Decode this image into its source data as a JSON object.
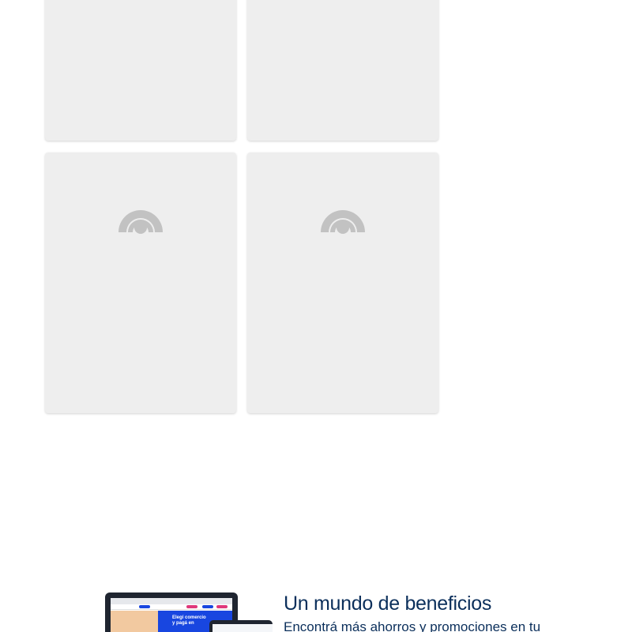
{
  "cards": [
    {
      "state": "loaded-empty"
    },
    {
      "state": "loaded-empty"
    },
    {
      "state": "loading",
      "icon": "loading-wifi-icon"
    },
    {
      "state": "loading",
      "icon": "loading-wifi-icon"
    }
  ],
  "promo": {
    "title": "Un mundo de beneficios",
    "subtitle": "Encontrá más ahorros y promociones en tu",
    "laptop_text_line1": "Elegí comercio",
    "laptop_text_line2": "y pagá en"
  },
  "colors": {
    "card_bg": "#eeeeee",
    "icon_gray": "#c2c2c2",
    "title_navy": "#0b2f5b",
    "hero_blue": "#1846e0"
  }
}
